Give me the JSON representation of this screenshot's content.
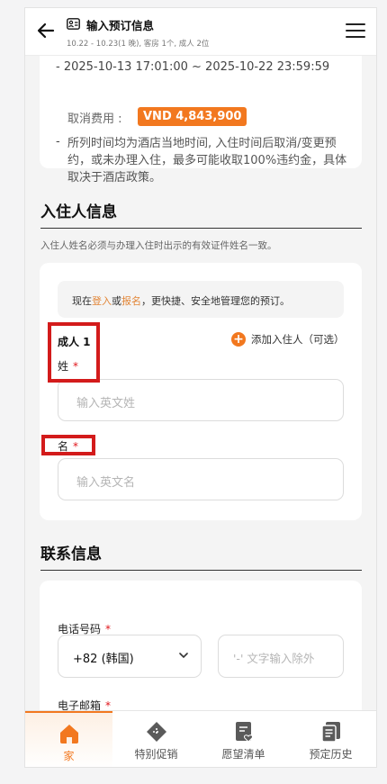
{
  "header": {
    "title": "输入预订信息",
    "subtitle": "10.22 - 10.23(1 晚), 客房 1个, 成人 2位",
    "back_icon": "arrow-left-icon",
    "doc_icon": "id-card-icon",
    "menu_icon": "hamburger-menu-icon"
  },
  "cancellation": {
    "period": "- 2025-10-13 17:01:00 ~ 2025-10-22 23:59:59",
    "fee_label": "取消费用 :",
    "fee_value": "VND 4,843,900",
    "policy_dash": "-",
    "policy_text": "所列时间均为酒店当地时间, 入住时间后取消/变更预约，或未办理入住，最多可能收取100%违约金，具体取决于酒店政策。"
  },
  "guest_section": {
    "title": "入住人信息",
    "note": "入住人姓名必须与办理入住时出示的有效证件姓名一致。",
    "login_prefix": "现在",
    "login_link": "登入",
    "login_or": "或",
    "signup_link": "报名",
    "login_suffix": "，更快捷、安全地管理您的预订。",
    "adult_label": "成人 1",
    "add_guest": "添加入住人（可选）",
    "last_name_label": "姓",
    "last_name_placeholder": "输入英文姓",
    "first_name_label": "名",
    "first_name_placeholder": "输入英文名",
    "required_mark": "*"
  },
  "contact_section": {
    "title": "联系信息",
    "phone_label": "电话号码",
    "country_code": "+82 (韩国)",
    "phone_placeholder": "'-' 文字输入除外",
    "email_label": "电子邮箱",
    "required_mark": "*"
  },
  "bottom_nav": {
    "items": [
      {
        "label": "家",
        "icon": "home-icon",
        "active": true
      },
      {
        "label": "特别促销",
        "icon": "ticket-icon",
        "active": false
      },
      {
        "label": "愿望清单",
        "icon": "wishlist-icon",
        "active": false
      },
      {
        "label": "预定历史",
        "icon": "history-icon",
        "active": false
      }
    ]
  },
  "colors": {
    "accent": "#f2781f",
    "highlight_box": "#d31b1b",
    "required": "#e0161b"
  }
}
